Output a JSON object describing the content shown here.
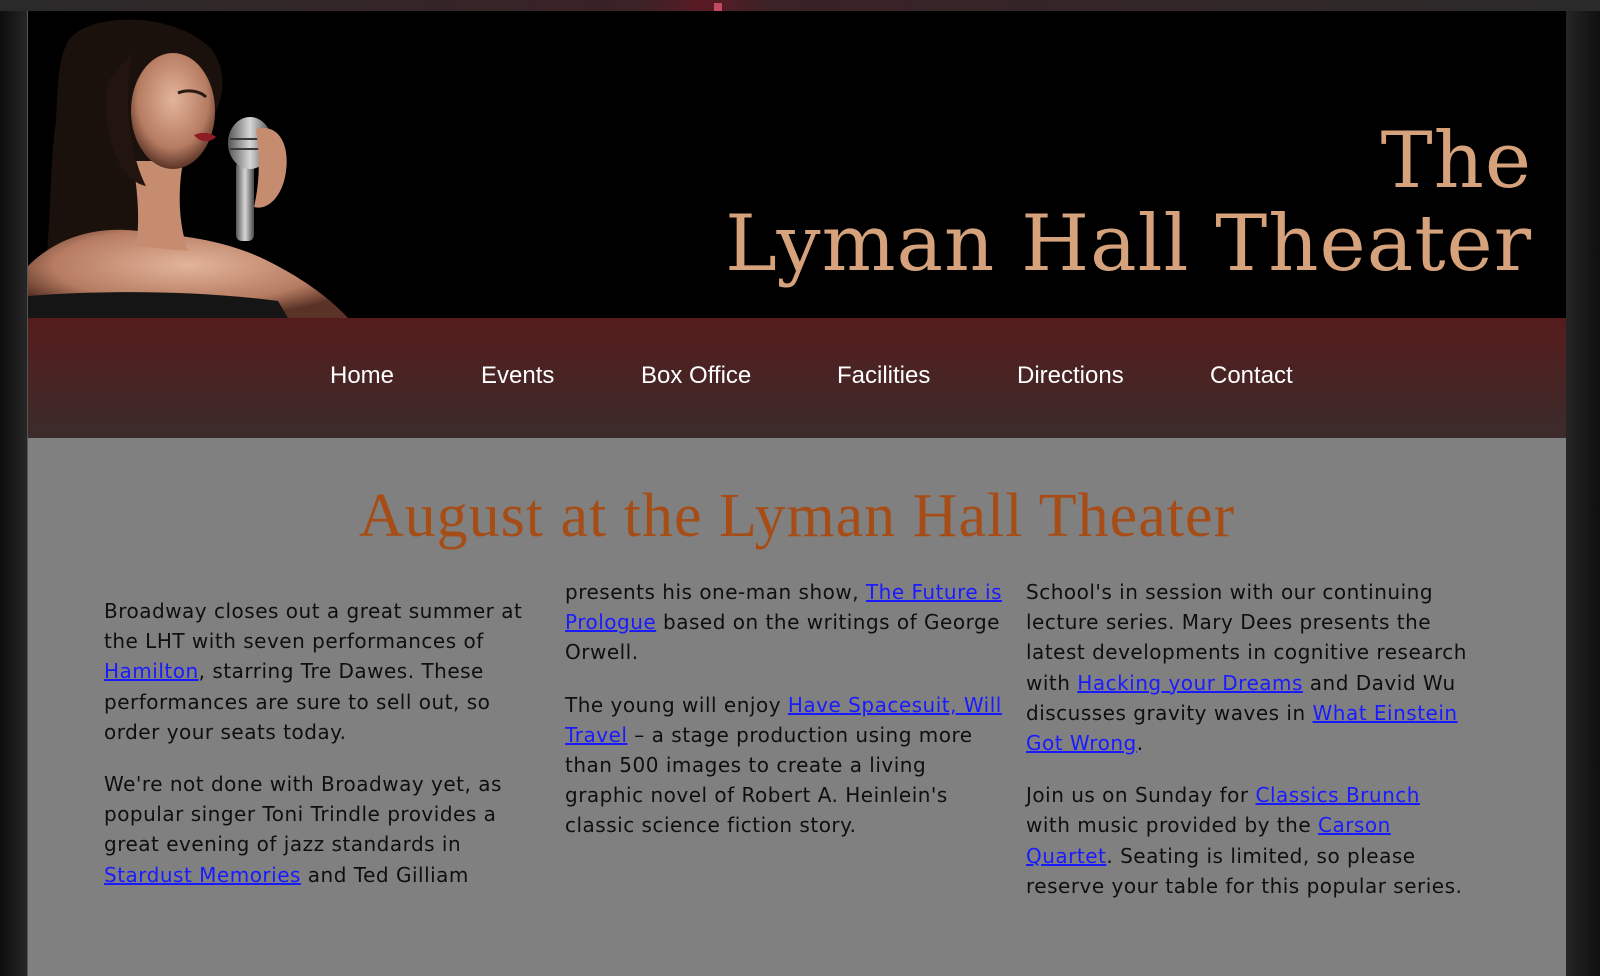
{
  "site": {
    "title_line1": "The",
    "title_line2": "Lyman Hall Theater"
  },
  "nav": {
    "items": [
      "Home",
      "Events",
      "Box Office",
      "Facilities",
      "Directions",
      "Contact"
    ]
  },
  "headline": "August at the Lyman Hall Theater",
  "col1": {
    "p1": {
      "t1": "Broadway closes out a great summer at the LHT with seven performances of ",
      "link": "Hamilton",
      "t2": ", starring Tre Dawes. These performances are sure to sell out, so order your seats today."
    },
    "p2": {
      "t1": "We're not done with Broadway yet, as popular singer Toni Trindle provides a great evening of jazz standards in ",
      "link": "Stardust Memories",
      "t2": " and Ted Gilliam"
    }
  },
  "col2": {
    "p1": {
      "t1": "presents his one-man show, ",
      "link": "The Future is Prologue",
      "t2": " based on the writings of George Orwell."
    },
    "p2": {
      "t1": "The young will enjoy ",
      "link": "Have Spacesuit, Will Travel",
      "t2": " – a stage production using more than 500 images to create a living graphic novel of Robert A. Heinlein's classic science fiction story."
    }
  },
  "col3": {
    "p1": {
      "t1": "School's in session with our continuing lecture series. Mary Dees presents the latest developments in cognitive research with ",
      "link1": "Hacking your Dreams",
      "t2": " and David Wu discusses gravity waves in ",
      "link2": "What Einstein Got Wrong",
      "t3": "."
    },
    "p2": {
      "t1": "Join us on Sunday for ",
      "link1": "Classics Brunch",
      "t2": " with music provided by the ",
      "link2": "Carson Quartet",
      "t3": ". Seating is limited, so please reserve your table for this popular series."
    }
  },
  "colors": {
    "nav_bg_top": "#561c1c",
    "headline": "#a64d17",
    "link": "#1a1aff",
    "brand_text": "#d6a27c",
    "content_bg": "#808080"
  }
}
